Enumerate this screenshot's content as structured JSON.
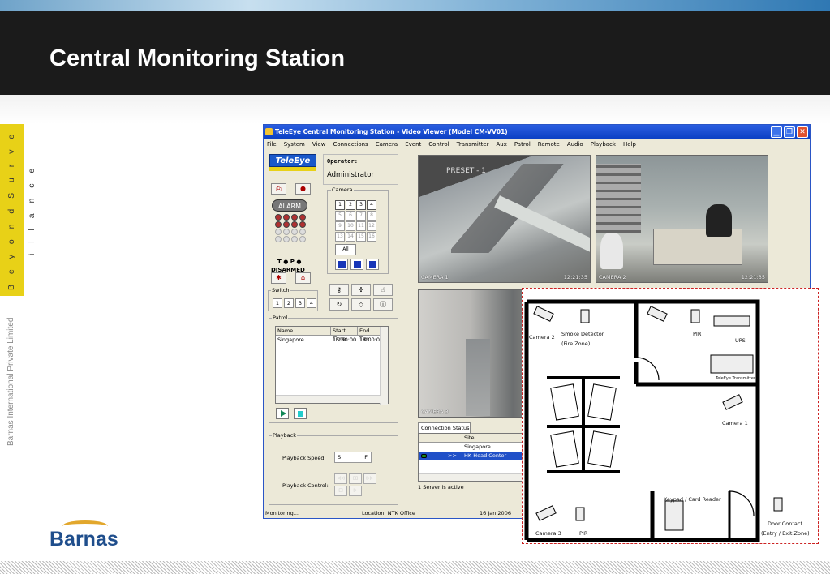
{
  "slide": {
    "title": "Central Monitoring Station",
    "tagline": "B e y o n d   S u r v e i l l a n c e",
    "company": "Barnas International Private Limited",
    "logo_text": "Barnas"
  },
  "window": {
    "title": "TeleEye Central Monitoring Station - Video Viewer (Model CM-VV01)",
    "menu": [
      "File",
      "System",
      "View",
      "Connections",
      "Camera",
      "Event",
      "Control",
      "Transmitter",
      "Aux",
      "Patrol",
      "Remote",
      "Audio",
      "Playback",
      "Help"
    ],
    "logo": "TeleEye",
    "operator_label": "Operator:",
    "operator_value": "Administrator",
    "alarm_label": "ALARM",
    "top_label": "T ● P ●",
    "disarmed_label": "DISARMED",
    "camera_group_label": "Camera",
    "camera_numbers": [
      "1",
      "2",
      "3",
      "4",
      "5",
      "6",
      "7",
      "8",
      "9",
      "10",
      "11",
      "12",
      "13",
      "14",
      "15",
      "16"
    ],
    "all_label": "All",
    "switch_label": "Switch",
    "switch_buttons": [
      "1",
      "2",
      "3",
      "4"
    ],
    "patrol": {
      "label": "Patrol",
      "columns": [
        "Name",
        "Start Time",
        "End Tim"
      ],
      "rows": [
        [
          "Singapore",
          "15:00:00",
          "18:00:0("
        ]
      ]
    },
    "playback": {
      "label": "Playback",
      "speed_label": "Playback Speed:",
      "speed_s": "S",
      "speed_f": "F",
      "control_label": "Playback Control:"
    },
    "cameras": [
      {
        "label": "CAMERA 1",
        "time": "12:21:35",
        "overlay": "PRESET - 1"
      },
      {
        "label": "CAMERA 2",
        "time": "12:21:35"
      },
      {
        "label": "CAMERA 3"
      }
    ],
    "connection": {
      "tab": "Connection Status",
      "header": "Site",
      "rows": [
        {
          "arrow": "",
          "site": "Singapore",
          "selected": false
        },
        {
          "arrow": ">>",
          "site": "HK Head Center",
          "selected": true
        }
      ],
      "summary": "1 Server is active"
    },
    "statusbar": {
      "state": "Monitoring...",
      "location": "Location: NTK Office",
      "date": "16 Jan 2006"
    }
  },
  "floorplan": {
    "labels": {
      "camera2": "Camera 2",
      "smoke": "Smoke Detector",
      "fire_zone": "(Fire Zone)",
      "pir_top": "PIR",
      "ups": "UPS",
      "transmitter": "TeleEye Transmitter",
      "camera1": "Camera 1",
      "keypad": "Keypad / Card Reader",
      "door": "Door Contact",
      "entry_exit": "(Entry / Exit Zone)",
      "camera3": "Camera 3",
      "pir_bottom": "PIR"
    }
  }
}
